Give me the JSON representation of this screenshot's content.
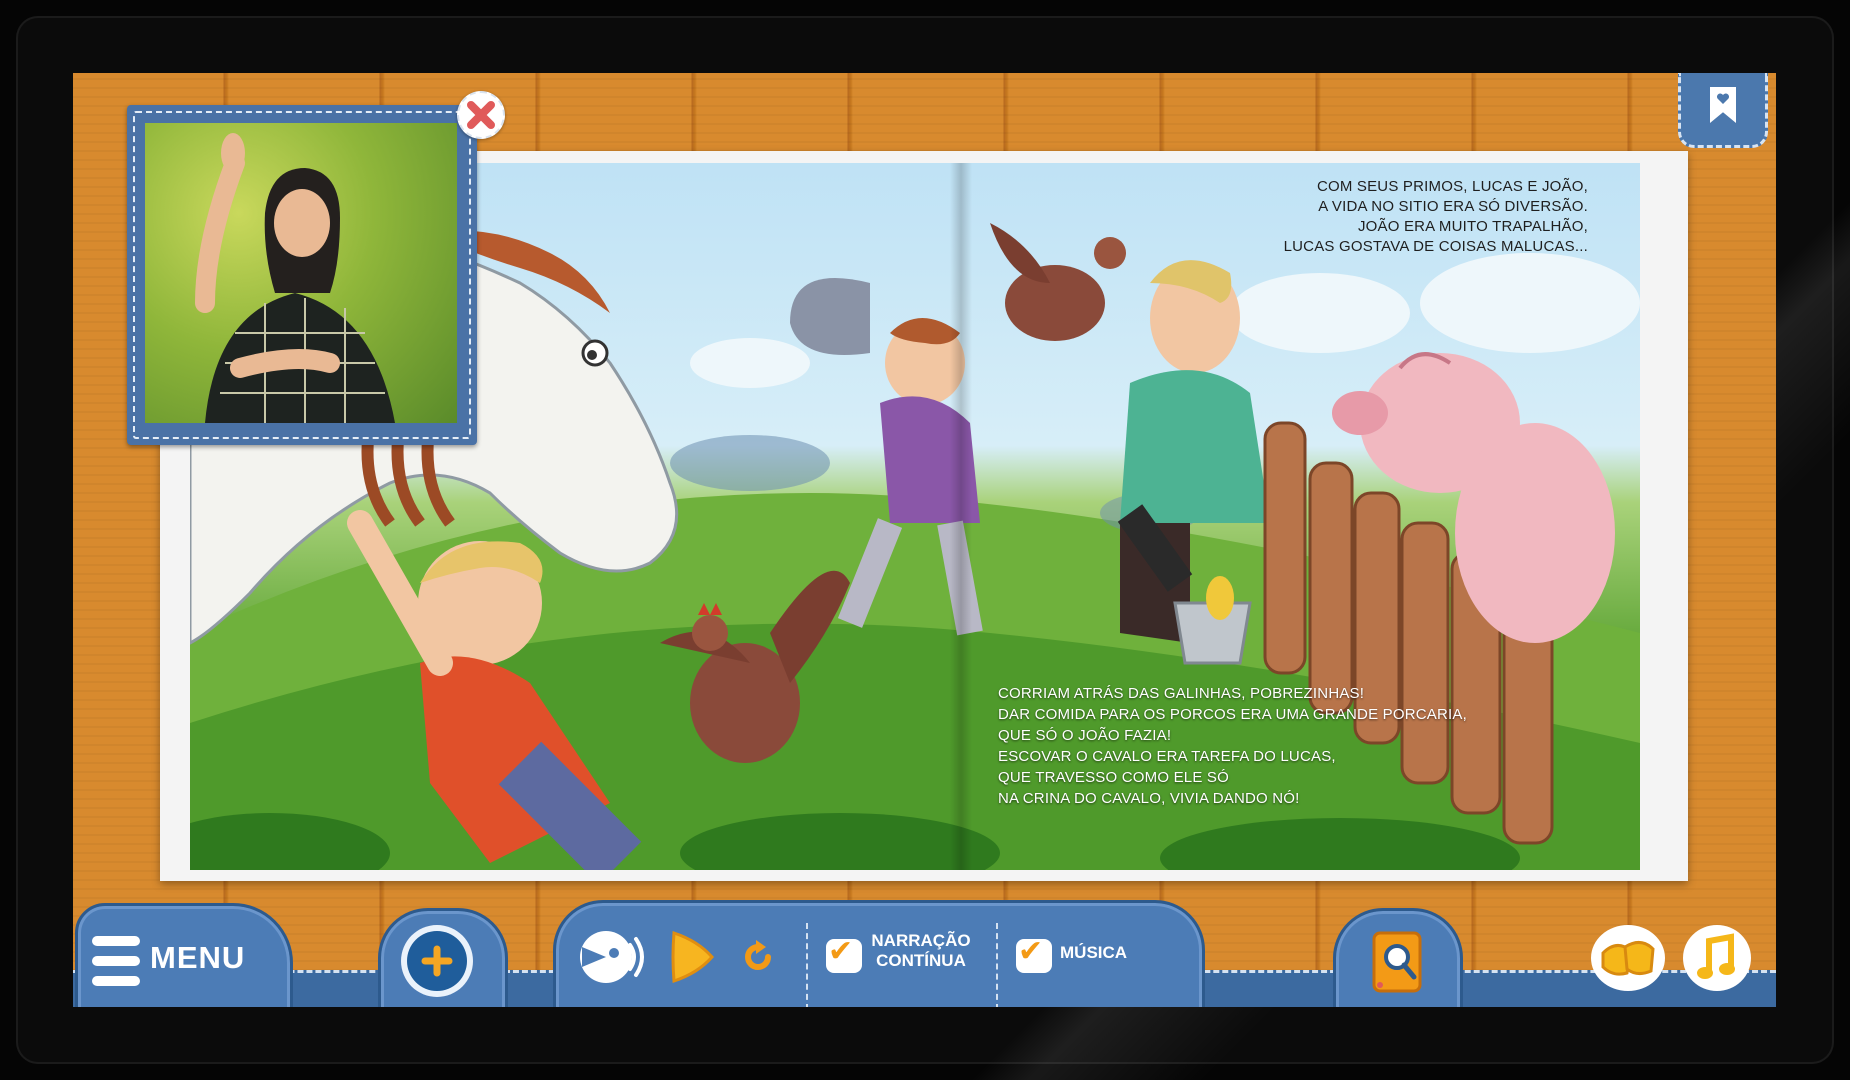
{
  "bookmark": {
    "icon": "bookmark-heart-icon"
  },
  "page": {
    "top_text": [
      "COM SEUS PRIMOS, LUCAS E JOÃO,",
      "A VIDA NO SITIO ERA SÓ DIVERSÃO.",
      "JOÃO ERA MUITO TRAPALHÃO,",
      "LUCAS GOSTAVA DE COISAS MALUCAS..."
    ],
    "bottom_text": [
      "CORRIAM ATRÁS DAS GALINHAS, POBREZINHAS!",
      "DAR COMIDA PARA OS PORCOS ERA UMA GRANDE PORCARIA,",
      "QUE SÓ O JOÃO FAZIA!",
      "ESCOVAR O CAVALO ERA TAREFA DO LUCAS,",
      "QUE TRAVESSO COMO ELE SÓ",
      "NA CRINA DO CAVALO, VIVIA DANDO NÓ!"
    ]
  },
  "sign_video": {
    "close_icon": "close-icon"
  },
  "toolbar": {
    "menu_label": "MENU",
    "zoom_icon": "zoom-in-icon",
    "audio_icon": "sound-icon",
    "play_icon": "play-icon",
    "replay_icon": "replay-icon",
    "narration_line1": "NARRAÇÃO",
    "narration_line2": "CONTÍNUA",
    "narration_checked": true,
    "music_label": "MÚSICA",
    "music_checked": true,
    "glossary_icon": "glossary-book-icon",
    "language_icon": "sign-language-icon",
    "music_note_icon": "music-note-icon"
  },
  "colors": {
    "wood": "#d88a2e",
    "button_blue": "#4c7cb6",
    "accent_orange": "#f39a16",
    "close_red": "#e05a5a"
  }
}
